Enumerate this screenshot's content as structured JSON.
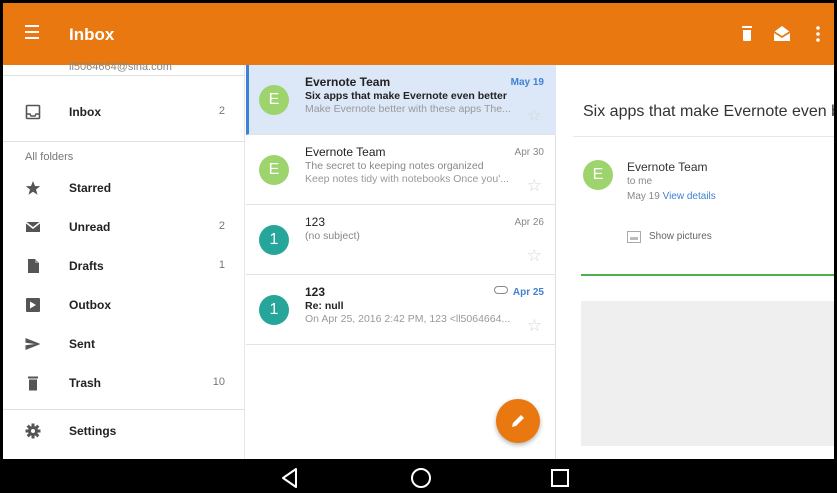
{
  "appbar": {
    "title": "Inbox",
    "color": "#E8780F",
    "icons": [
      "menu-icon",
      "delete-icon",
      "mark-read-icon",
      "more-vert-icon"
    ]
  },
  "drawer": {
    "account_partial": "ll5064664@sina.com",
    "inbox": {
      "label": "Inbox",
      "count": "2"
    },
    "folders_header": "All folders",
    "items": [
      {
        "label": "Starred",
        "count": "",
        "icon": "star-icon"
      },
      {
        "label": "Unread",
        "count": "2",
        "icon": "envelope-icon"
      },
      {
        "label": "Drafts",
        "count": "1",
        "icon": "draft-icon"
      },
      {
        "label": "Outbox",
        "count": "",
        "icon": "outbox-icon"
      },
      {
        "label": "Sent",
        "count": "",
        "icon": "send-icon"
      },
      {
        "label": "Trash",
        "count": "10",
        "icon": "trash-icon"
      }
    ],
    "settings": {
      "label": "Settings",
      "icon": "gear-icon"
    }
  },
  "messages": [
    {
      "avatar": "E",
      "avatar_color": "#9ED46D",
      "from": "Evernote Team",
      "date": "May 19",
      "subject": "Six apps that make Evernote even better",
      "preview": "Make Evernote better with these apps The...",
      "unread": true,
      "selected": true
    },
    {
      "avatar": "E",
      "avatar_color": "#9ED46D",
      "from": "Evernote Team",
      "date": "Apr 30",
      "subject": "The secret to keeping notes organized",
      "preview": "Keep notes tidy with notebooks Once you'...",
      "unread": false,
      "selected": false
    },
    {
      "avatar": "1",
      "avatar_color": "#26A69A",
      "from": "123",
      "date": "Apr 26",
      "subject": "(no subject)",
      "preview": "",
      "unread": false,
      "selected": false
    },
    {
      "avatar": "1",
      "avatar_color": "#26A69A",
      "from": "123",
      "date": "Apr 25",
      "subject": "Re: null",
      "preview": "On Apr 25, 2016 2:42 PM, 123 <ll5064664...",
      "unread": true,
      "selected": false,
      "attachment": true
    }
  ],
  "reading_pane": {
    "subject": "Six apps that make Evernote even b",
    "avatar": "E",
    "sender": "Evernote Team",
    "to": "to me",
    "date": "May 19",
    "details_link": "View details",
    "show_pictures": "Show pictures"
  },
  "fab": {
    "icon": "pencil-icon",
    "color": "#E8780F"
  },
  "navbar": {
    "icons": [
      "back-icon",
      "home-icon",
      "recents-icon"
    ]
  }
}
